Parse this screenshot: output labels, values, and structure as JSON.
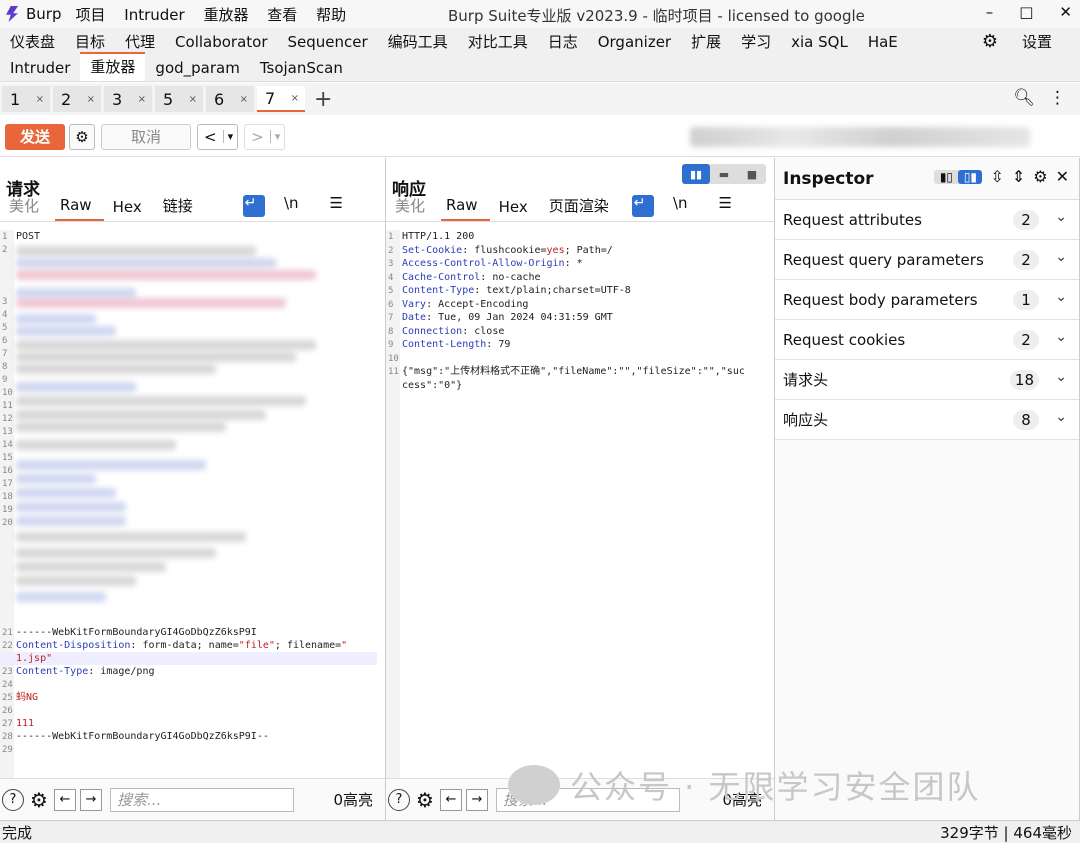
{
  "titlebar": {
    "app": "Burp",
    "menu": [
      "项目",
      "Intruder",
      "重放器",
      "查看",
      "帮助"
    ],
    "title": "Burp Suite专业版  v2023.9 - 临时项目 - licensed to google",
    "controls": [
      "–",
      "□",
      "✕"
    ]
  },
  "tabs_row1": [
    "仪表盘",
    "目标",
    "代理",
    "Collaborator",
    "Sequencer",
    "编码工具",
    "对比工具",
    "日志",
    "Organizer",
    "扩展",
    "学习",
    "xia SQL",
    "HaE"
  ],
  "settings_label": "设置",
  "tabs_row2": [
    "Intruder",
    "重放器",
    "god_param",
    "TsojanScan"
  ],
  "tabs_row2_active": "重放器",
  "repeater_tabs": [
    {
      "label": "1",
      "x": "×"
    },
    {
      "label": "2",
      "x": "×"
    },
    {
      "label": "3",
      "x": "×"
    },
    {
      "label": "5",
      "x": "×"
    },
    {
      "label": "6",
      "x": "×"
    },
    {
      "label": "7",
      "x": "×"
    }
  ],
  "plus": "+",
  "toolbar": {
    "send": "发送",
    "cancel": "取消",
    "back": "<",
    "fwd": ">",
    "dd": "▾"
  },
  "request": {
    "title": "请求",
    "tabs": [
      "美化",
      "Raw",
      "Hex",
      "链接"
    ],
    "active_tab": "Raw",
    "newline": "\\n",
    "lines": [
      {
        "n": "1",
        "t": "POST"
      },
      {
        "n": "2",
        "t": ""
      },
      {
        "n": "3",
        "t": ""
      },
      {
        "n": "4",
        "t": ""
      },
      {
        "n": "5",
        "t": ""
      },
      {
        "n": "6",
        "t": ""
      },
      {
        "n": "7",
        "t": ""
      },
      {
        "n": "8",
        "t": ""
      },
      {
        "n": "9",
        "t": ""
      },
      {
        "n": "10",
        "t": ""
      },
      {
        "n": "11",
        "t": ""
      },
      {
        "n": "12",
        "t": ""
      },
      {
        "n": "13",
        "t": ""
      },
      {
        "n": "14",
        "t": ""
      },
      {
        "n": "15",
        "t": ""
      },
      {
        "n": "16",
        "t": ""
      },
      {
        "n": "17",
        "t": ""
      },
      {
        "n": "18",
        "t": ""
      },
      {
        "n": "19",
        "t": ""
      },
      {
        "n": "20",
        "t": ""
      },
      {
        "n": "21",
        "t": "------WebKitFormBoundaryGI4GoDbQzZ6ksP9I"
      },
      {
        "n": "22",
        "k": "Content-Disposition",
        "v": " form-data; name=",
        "s1": "\"file\"",
        "v2": "; filename=",
        "s2": "\""
      },
      {
        "n": "",
        "s": "1.jsp\""
      },
      {
        "n": "23",
        "k": "Content-Type",
        "v": " image/png"
      },
      {
        "n": "24",
        "t": ""
      },
      {
        "n": "25",
        "s": "蚂NG"
      },
      {
        "n": "26",
        "t": ""
      },
      {
        "n": "27",
        "s": "111"
      },
      {
        "n": "28",
        "t": "------WebKitFormBoundaryGI4GoDbQzZ6ksP9I--"
      },
      {
        "n": "29",
        "t": ""
      }
    ],
    "search_placeholder": "搜索...",
    "hits": "0高亮"
  },
  "response": {
    "title": "响应",
    "tabs": [
      "美化",
      "Raw",
      "Hex",
      "页面渲染"
    ],
    "active_tab": "Raw",
    "newline": "\\n",
    "lines": [
      {
        "n": "1",
        "t": "HTTP/1.1 200"
      },
      {
        "n": "2",
        "k": "Set-Cookie",
        "v": " flushcookie=",
        "r": "yes",
        "v2": "; Path=/"
      },
      {
        "n": "3",
        "k": "Access-Control-Allow-Origin",
        "v": " *"
      },
      {
        "n": "4",
        "k": "Cache-Control",
        "v": " no-cache"
      },
      {
        "n": "5",
        "k": "Content-Type",
        "v": " text/plain;charset=UTF-8"
      },
      {
        "n": "6",
        "k": "Vary",
        "v": " Accept-Encoding"
      },
      {
        "n": "7",
        "k": "Date",
        "v": " Tue, 09 Jan 2024 04:31:59 GMT"
      },
      {
        "n": "8",
        "k": "Connection",
        "v": " close"
      },
      {
        "n": "9",
        "k": "Content-Length",
        "v": " 79"
      },
      {
        "n": "10",
        "t": ""
      },
      {
        "n": "11",
        "t": "{\"msg\":\"上传材料格式不正确\",\"fileName\":\"\",\"fileSize\":\"\",\"suc"
      },
      {
        "n": "",
        "t": "cess\":\"0\"}"
      }
    ],
    "search_placeholder": "搜索...",
    "hits": "0高亮"
  },
  "inspector": {
    "title": "Inspector",
    "rows": [
      {
        "label": "Request attributes",
        "count": "2"
      },
      {
        "label": "Request query parameters",
        "count": "2"
      },
      {
        "label": "Request body parameters",
        "count": "1"
      },
      {
        "label": "Request cookies",
        "count": "2"
      },
      {
        "label": "请求头",
        "count": "18"
      },
      {
        "label": "响应头",
        "count": "8"
      }
    ]
  },
  "status": {
    "left": "完成",
    "right": "329字节 | 464毫秒"
  },
  "watermark": "公众号 · 无限学习安全团队",
  "colors": {
    "accent": "#e8663a",
    "blue": "#2f6fd2",
    "header_key": "#2a3eb8",
    "string_red": "#b22222"
  }
}
